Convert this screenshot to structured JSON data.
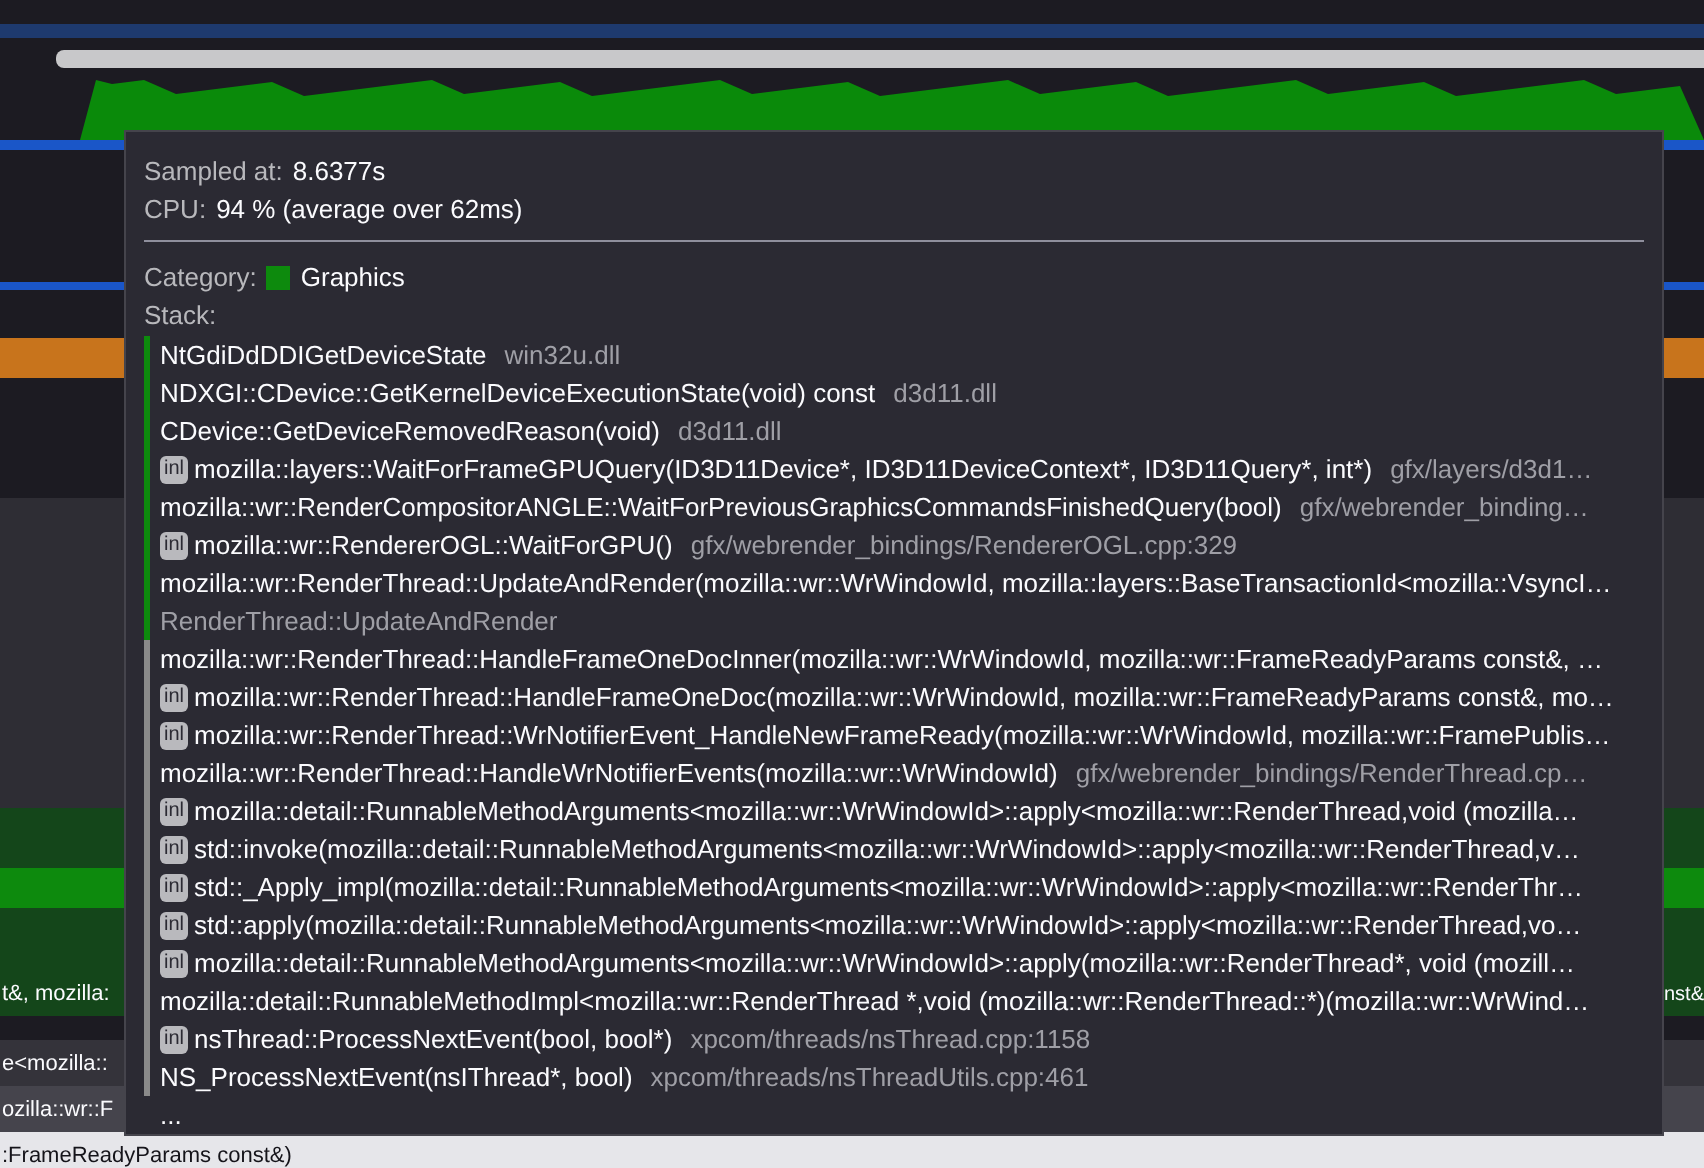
{
  "tooltip": {
    "sampled_label": "Sampled at:",
    "sampled_value": "8.6377s",
    "cpu_label": "CPU:",
    "cpu_value": "94 % (average over 62ms)",
    "category_label": "Category:",
    "category": {
      "name": "Graphics",
      "color": "#0d8a0d"
    },
    "stack_label": "Stack:",
    "frames": [
      {
        "kind": "frame",
        "name": "NtGdiDdDDIGetDeviceState",
        "origin": "win32u.dll",
        "color": "#0d8a0d"
      },
      {
        "kind": "frame",
        "name": "NDXGI::CDevice::GetKernelDeviceExecutionState(void) const",
        "origin": "d3d11.dll",
        "color": "#0d8a0d"
      },
      {
        "kind": "frame",
        "name": "CDevice::GetDeviceRemovedReason(void)",
        "origin": "d3d11.dll",
        "color": "#0d8a0d"
      },
      {
        "kind": "frame",
        "badge": "inl",
        "name": "mozilla::layers::WaitForFrameGPUQuery(ID3D11Device*, ID3D11DeviceContext*, ID3D11Query*, int*)",
        "origin": "gfx/layers/d3d1…",
        "color": "#0d8a0d"
      },
      {
        "kind": "frame",
        "name": "mozilla::wr::RenderCompositorANGLE::WaitForPreviousGraphicsCommandsFinishedQuery(bool)",
        "origin": "gfx/webrender_binding…",
        "color": "#0d8a0d"
      },
      {
        "kind": "frame",
        "badge": "inl",
        "name": "mozilla::wr::RendererOGL::WaitForGPU()",
        "origin": "gfx/webrender_bindings/RendererOGL.cpp:329",
        "color": "#0d8a0d"
      },
      {
        "kind": "frame",
        "name": "mozilla::wr::RenderThread::UpdateAndRender(mozilla::wr::WrWindowId, mozilla::layers::BaseTransactionId<mozilla::VsyncI…",
        "color": "#0d8a0d"
      },
      {
        "kind": "label",
        "name": "RenderThread::UpdateAndRender",
        "color": "#0d8a0d"
      },
      {
        "kind": "frame",
        "name": "mozilla::wr::RenderThread::HandleFrameOneDocInner(mozilla::wr::WrWindowId, mozilla::wr::FrameReadyParams const&, …",
        "color": "#8a8a8a"
      },
      {
        "kind": "frame",
        "badge": "inl",
        "name": "mozilla::wr::RenderThread::HandleFrameOneDoc(mozilla::wr::WrWindowId, mozilla::wr::FrameReadyParams const&, mo…",
        "color": "#8a8a8a"
      },
      {
        "kind": "frame",
        "badge": "inl",
        "name": "mozilla::wr::RenderThread::WrNotifierEvent_HandleNewFrameReady(mozilla::wr::WrWindowId, mozilla::wr::FramePublis…",
        "color": "#8a8a8a"
      },
      {
        "kind": "frame",
        "name": "mozilla::wr::RenderThread::HandleWrNotifierEvents(mozilla::wr::WrWindowId)",
        "origin": "gfx/webrender_bindings/RenderThread.cp…",
        "color": "#8a8a8a"
      },
      {
        "kind": "frame",
        "badge": "inl",
        "name": "mozilla::detail::RunnableMethodArguments<mozilla::wr::WrWindowId>::apply<mozilla::wr::RenderThread,void (mozilla…",
        "color": "#8a8a8a"
      },
      {
        "kind": "frame",
        "badge": "inl",
        "name": "std::invoke(mozilla::detail::RunnableMethodArguments<mozilla::wr::WrWindowId>::apply<mozilla::wr::RenderThread,v…",
        "color": "#8a8a8a"
      },
      {
        "kind": "frame",
        "badge": "inl",
        "name": "std::_Apply_impl(mozilla::detail::RunnableMethodArguments<mozilla::wr::WrWindowId>::apply<mozilla::wr::RenderThr…",
        "color": "#8a8a8a"
      },
      {
        "kind": "frame",
        "badge": "inl",
        "name": "std::apply(mozilla::detail::RunnableMethodArguments<mozilla::wr::WrWindowId>::apply<mozilla::wr::RenderThread,vo…",
        "color": "#8a8a8a"
      },
      {
        "kind": "frame",
        "badge": "inl",
        "name": "mozilla::detail::RunnableMethodArguments<mozilla::wr::WrWindowId>::apply(mozilla::wr::RenderThread*, void (mozill…",
        "color": "#8a8a8a"
      },
      {
        "kind": "frame",
        "name": "mozilla::detail::RunnableMethodImpl<mozilla::wr::RenderThread *,void (mozilla::wr::RenderThread::*)(mozilla::wr::WrWind…",
        "color": "#8a8a8a"
      },
      {
        "kind": "frame",
        "badge": "inl",
        "name": "nsThread::ProcessNextEvent(bool, bool*)",
        "origin": "xpcom/threads/nsThread.cpp:1158",
        "color": "#8a8a8a"
      },
      {
        "kind": "frame",
        "name": "NS_ProcessNextEvent(nsIThread*, bool)",
        "origin": "xpcom/threads/nsThreadUtils.cpp:461",
        "color": "#8a8a8a"
      }
    ],
    "more": "..."
  },
  "flame_rows": [
    {
      "left": "t&, mozilla:",
      "right": "nst&"
    },
    {
      "left": "e<mozilla::"
    },
    {
      "left": "ozilla::wr::F"
    },
    {
      "left": ":FrameReadyParams const&)"
    }
  ]
}
